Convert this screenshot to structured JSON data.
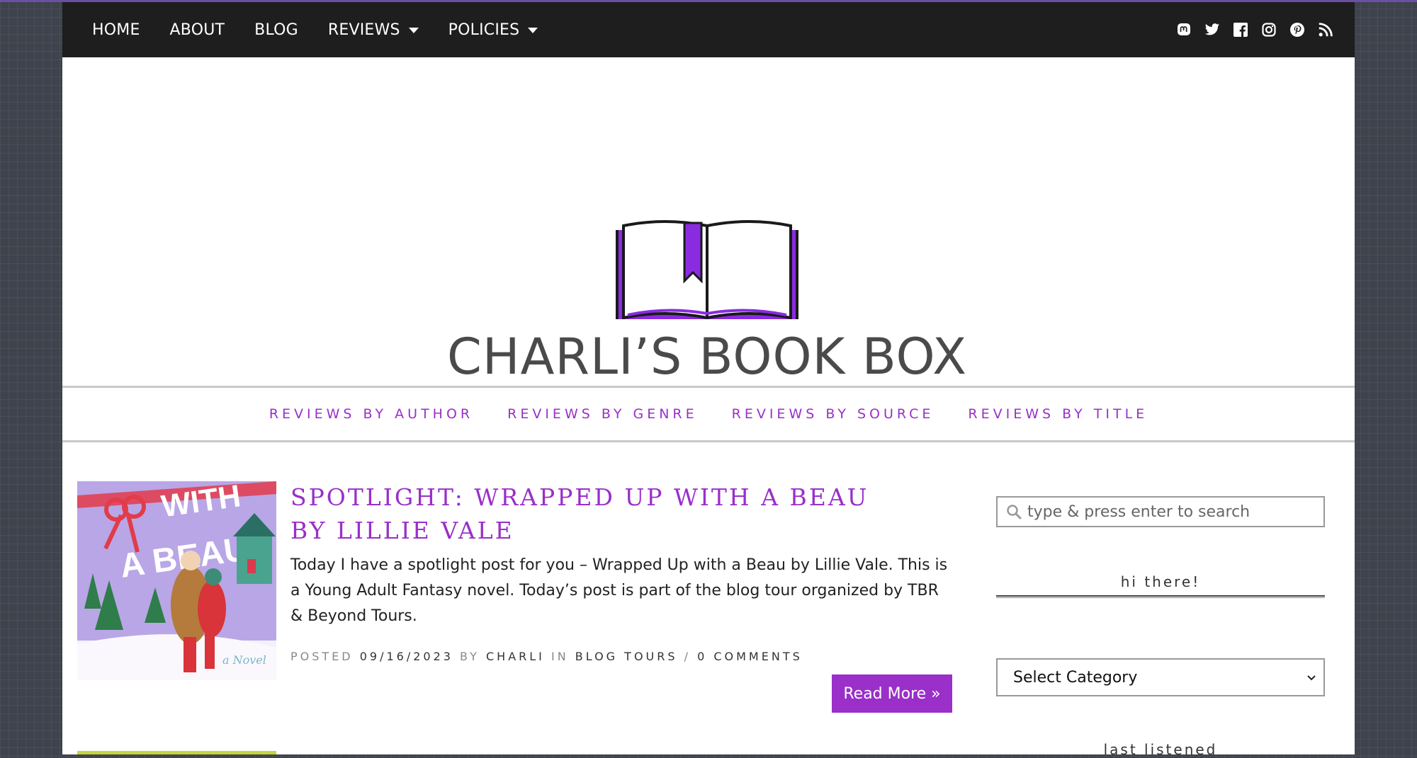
{
  "topnav": {
    "items": [
      {
        "label": "HOME",
        "dropdown": false
      },
      {
        "label": "ABOUT",
        "dropdown": false
      },
      {
        "label": "BLOG",
        "dropdown": false
      },
      {
        "label": "REVIEWS",
        "dropdown": true
      },
      {
        "label": "POLICIES",
        "dropdown": true
      }
    ],
    "social_icons": [
      "mastodon-icon",
      "twitter-icon",
      "facebook-icon",
      "instagram-icon",
      "pinterest-icon",
      "rss-icon"
    ]
  },
  "site": {
    "logo_text": "CHARLI’S BOOK BOX"
  },
  "subnav": {
    "items": [
      "REVIEWS BY AUTHOR",
      "REVIEWS BY GENRE",
      "REVIEWS BY SOURCE",
      "REVIEWS BY TITLE"
    ]
  },
  "post": {
    "title": "SPOTLIGHT: WRAPPED UP WITH A BEAU BY LILLIE VALE",
    "excerpt": "Today I have a spotlight post for you – Wrapped Up with a Beau by Lillie Vale. This is a Young Adult Fantasy novel. Today’s post is part of the blog tour organized by TBR & Beyond Tours.",
    "meta": {
      "posted_label": "POSTED",
      "date": "09/16/2023",
      "by_label": "BY",
      "author": "CHARLI",
      "in_label": "IN",
      "category": "BLOG TOURS",
      "separator": "/",
      "comments": "0 COMMENTS"
    },
    "read_more": "Read More »",
    "thumb_text": [
      "WITH",
      "A BEAU",
      "a Novel"
    ]
  },
  "sidebar": {
    "search_placeholder": "type & press enter to search",
    "hi_title": "hi there!",
    "category_select": "Select Category",
    "last_listened_title": "last listened"
  },
  "colors": {
    "accent": "#9a2fc9",
    "topbar": "#1e1e1e",
    "background": "#3e434d"
  }
}
